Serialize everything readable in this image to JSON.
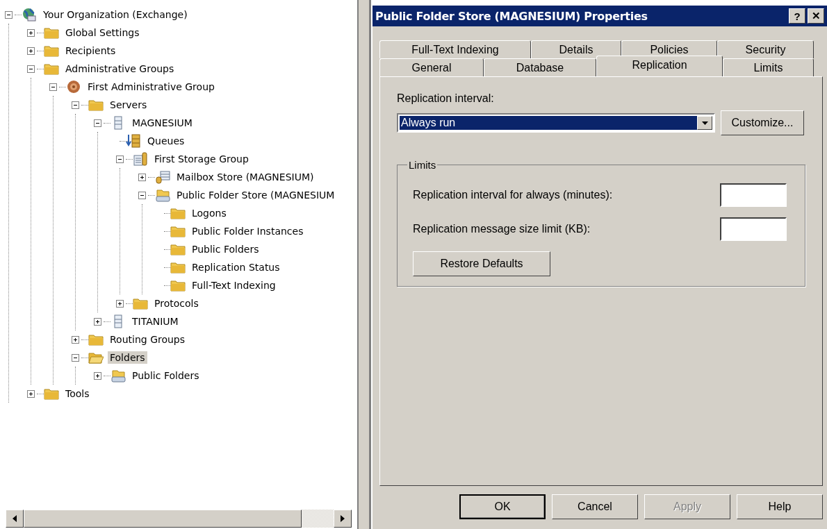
{
  "tree": [
    {
      "label": "Your Organization (Exchange)",
      "kind": "globe",
      "expanded": true,
      "selected": false,
      "children": [
        {
          "label": "Global Settings",
          "kind": "folder",
          "expanded": false,
          "selected": false
        },
        {
          "label": "Recipients",
          "kind": "folder",
          "expanded": false,
          "selected": false
        },
        {
          "label": "Administrative Groups",
          "kind": "folder",
          "expanded": true,
          "selected": false,
          "children": [
            {
              "label": "First Administrative Group",
              "kind": "group",
              "expanded": true,
              "selected": false,
              "children": [
                {
                  "label": "Servers",
                  "kind": "folder",
                  "expanded": true,
                  "selected": false,
                  "children": [
                    {
                      "label": "MAGNESIUM",
                      "kind": "server",
                      "expanded": true,
                      "selected": false,
                      "children": [
                        {
                          "label": "Queues",
                          "kind": "queue",
                          "selected": false
                        },
                        {
                          "label": "First Storage Group",
                          "kind": "storage",
                          "expanded": true,
                          "selected": false,
                          "children": [
                            {
                              "label": "Mailbox Store (MAGNESIUM)",
                              "kind": "mailbox",
                              "expanded": false,
                              "selected": false
                            },
                            {
                              "label": "Public Folder Store (MAGNESIUM",
                              "kind": "store",
                              "expanded": true,
                              "selected": false,
                              "children": [
                                {
                                  "label": "Logons",
                                  "kind": "folder",
                                  "selected": false
                                },
                                {
                                  "label": "Public Folder Instances",
                                  "kind": "folder",
                                  "selected": false
                                },
                                {
                                  "label": "Public Folders",
                                  "kind": "folder",
                                  "selected": false
                                },
                                {
                                  "label": "Replication Status",
                                  "kind": "folder",
                                  "selected": false
                                },
                                {
                                  "label": "Full-Text Indexing",
                                  "kind": "folder",
                                  "selected": false
                                }
                              ]
                            }
                          ]
                        },
                        {
                          "label": "Protocols",
                          "kind": "folder",
                          "expanded": false,
                          "selected": false
                        }
                      ]
                    },
                    {
                      "label": "TITANIUM",
                      "kind": "server",
                      "expanded": false,
                      "selected": false
                    }
                  ]
                },
                {
                  "label": "Routing Groups",
                  "kind": "folder",
                  "expanded": false,
                  "selected": false
                },
                {
                  "label": "Folders",
                  "kind": "openfolder",
                  "expanded": true,
                  "selected": true,
                  "children": [
                    {
                      "label": "Public Folders",
                      "kind": "store",
                      "expanded": false,
                      "selected": false
                    }
                  ]
                }
              ]
            }
          ]
        },
        {
          "label": "Tools",
          "kind": "folder",
          "expanded": false,
          "selected": false
        }
      ]
    }
  ],
  "dialog": {
    "title": "Public Folder Store (MAGNESIUM) Properties",
    "title_buttons": [
      "?",
      "✕"
    ],
    "tab_rows": [
      [
        {
          "label": "Full-Text Indexing",
          "selected": false
        },
        {
          "label": "Details",
          "selected": false
        },
        {
          "label": "Policies",
          "selected": false
        },
        {
          "label": "Security",
          "selected": false
        }
      ],
      [
        {
          "label": "General",
          "selected": false
        },
        {
          "label": "Database",
          "selected": false
        },
        {
          "label": "Replication",
          "selected": true
        },
        {
          "label": "Limits",
          "selected": false
        }
      ]
    ],
    "replication_interval": {
      "label": "Replication interval:",
      "value": "Always run",
      "focused": true,
      "button": "Customize..."
    },
    "limits": {
      "title": "Limits",
      "fields": [
        {
          "label": "Replication interval for always (minutes):"
        },
        {
          "label": "Replication message size limit (KB):"
        }
      ],
      "button": "Restore Defaults"
    },
    "buttons": [
      {
        "label": "OK",
        "default": true,
        "disabled": false
      },
      {
        "label": "Cancel",
        "default": false,
        "disabled": false
      },
      {
        "label": "Apply",
        "default": false,
        "disabled": true
      },
      {
        "label": "Help",
        "default": false,
        "disabled": false
      }
    ]
  }
}
